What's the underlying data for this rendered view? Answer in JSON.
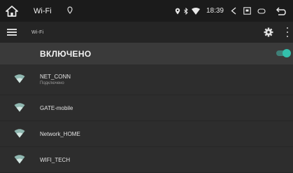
{
  "status_bar": {
    "title": "Wi-Fi",
    "time": "18:39"
  },
  "toolbar": {
    "title": "Wi-Fi"
  },
  "wifi_toggle": {
    "label": "ВКЛЮЧЕНО",
    "enabled": true,
    "accent_color": "#33c0ac"
  },
  "networks": [
    {
      "name": "NET_CONN",
      "status": "Подключено"
    },
    {
      "name": "GATE-mobile",
      "status": ""
    },
    {
      "name": "Network_HOME",
      "status": ""
    },
    {
      "name": "WIFI_TECH",
      "status": ""
    }
  ]
}
